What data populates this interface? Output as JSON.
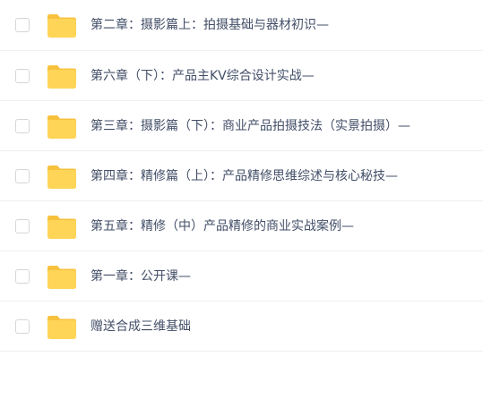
{
  "file_list": {
    "items": [
      {
        "name": "第二章：摄影篇上：拍摄基础与器材初识—",
        "icon": "folder-icon",
        "checked": false
      },
      {
        "name": "第六章（下）：产品主KV综合设计实战—",
        "icon": "folder-icon",
        "checked": false
      },
      {
        "name": "第三章：摄影篇（下）：商业产品拍摄技法（实景拍摄）—",
        "icon": "folder-icon",
        "checked": false
      },
      {
        "name": "第四章：精修篇（上）：产品精修思维综述与核心秘技—",
        "icon": "folder-icon",
        "checked": false
      },
      {
        "name": "第五章：精修（中）产品精修的商业实战案例—",
        "icon": "folder-icon",
        "checked": false
      },
      {
        "name": "第一章：公开课—",
        "icon": "folder-icon",
        "checked": false
      },
      {
        "name": "赠送合成三维基础",
        "icon": "folder-icon",
        "checked": false
      }
    ]
  },
  "colors": {
    "folder_body": "#ffd558",
    "folder_tab": "#f7c13d",
    "text": "#424e67",
    "divider": "#f0f0f2",
    "checkbox_border": "#d6d6da"
  }
}
